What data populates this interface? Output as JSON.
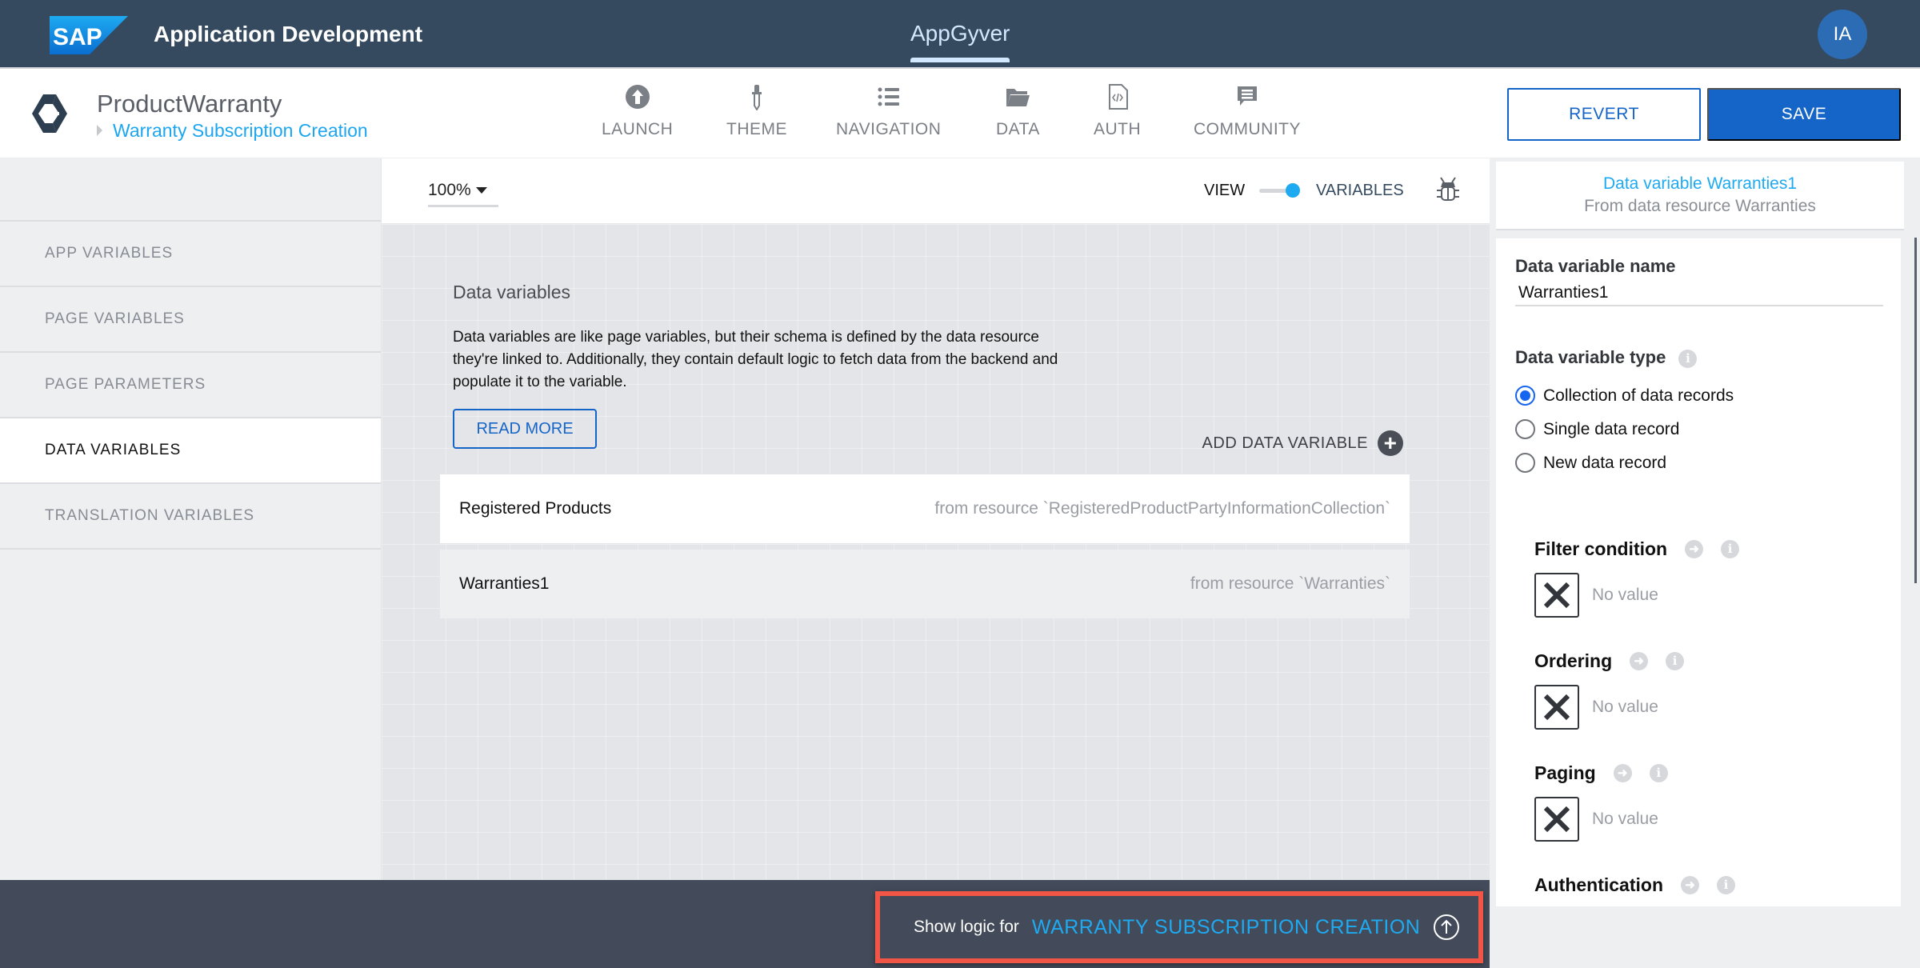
{
  "topbar": {
    "brand": "SAP",
    "app_title": "Application Development",
    "active_tab": "AppGyver",
    "user_initials": "IA"
  },
  "project": {
    "name": "ProductWarranty",
    "page": "Warranty Subscription Creation"
  },
  "nav": [
    {
      "label": "LAUNCH",
      "icon": "launch-icon"
    },
    {
      "label": "THEME",
      "icon": "theme-icon"
    },
    {
      "label": "NAVIGATION",
      "icon": "navigation-icon"
    },
    {
      "label": "DATA",
      "icon": "data-icon"
    },
    {
      "label": "AUTH",
      "icon": "auth-icon"
    },
    {
      "label": "COMMUNITY",
      "icon": "community-icon"
    }
  ],
  "actions": {
    "revert": "REVERT",
    "save": "SAVE"
  },
  "sidebar": {
    "items": [
      {
        "label": "APP VARIABLES",
        "active": false
      },
      {
        "label": "PAGE VARIABLES",
        "active": false
      },
      {
        "label": "PAGE PARAMETERS",
        "active": false
      },
      {
        "label": "DATA VARIABLES",
        "active": true
      },
      {
        "label": "TRANSLATION VARIABLES",
        "active": false
      }
    ]
  },
  "toolbar": {
    "zoom": "100%",
    "view_label": "VIEW",
    "variables_label": "VARIABLES"
  },
  "canvas": {
    "title": "Data variables",
    "description": "Data variables are like page variables, but their schema is defined by the data resource they're linked to. Additionally, they contain default logic to fetch data from the backend and populate it to the variable.",
    "read_more": "READ MORE",
    "add_label": "ADD DATA VARIABLE",
    "variables": [
      {
        "name": "Registered Products",
        "resource": "from resource `RegisteredProductPartyInformationCollection`",
        "selected": false
      },
      {
        "name": "Warranties1",
        "resource": "from resource `Warranties`",
        "selected": true
      }
    ]
  },
  "logic_bar": {
    "label": "Show logic for",
    "page": "WARRANTY SUBSCRIPTION CREATION"
  },
  "right_panel": {
    "title": "Data variable Warranties1",
    "subtitle": "From data resource Warranties",
    "name_label": "Data variable name",
    "name_value": "Warranties1",
    "type_label": "Data variable type",
    "type_options": [
      {
        "label": "Collection of data records",
        "selected": true
      },
      {
        "label": "Single data record",
        "selected": false
      },
      {
        "label": "New data record",
        "selected": false
      }
    ],
    "properties": [
      {
        "label": "Filter condition",
        "value": "No value"
      },
      {
        "label": "Ordering",
        "value": "No value"
      },
      {
        "label": "Paging",
        "value": "No value"
      },
      {
        "label": "Authentication",
        "value": null
      }
    ]
  },
  "colors": {
    "header_bg": "#354a5f",
    "accent_blue": "#1565c8",
    "link_blue": "#1eaaf1",
    "highlight_red": "#f05545"
  }
}
